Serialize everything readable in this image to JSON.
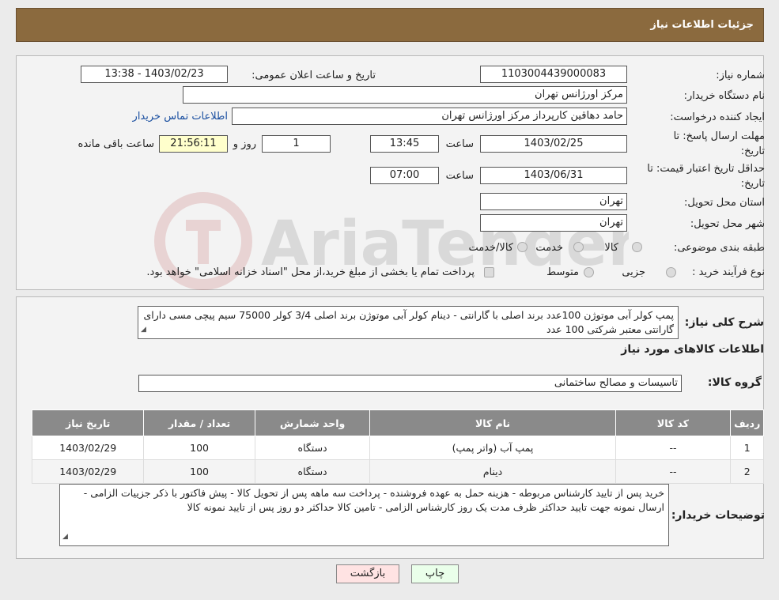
{
  "header": {
    "title": "جزئیات اطلاعات نیاز"
  },
  "form": {
    "need_number_label": "شماره نیاز:",
    "need_number": "1103004439000083",
    "announce_label": "تاریخ و ساعت اعلان عمومی:",
    "announce_value": "1403/02/23 - 13:38",
    "buyer_org_label": "نام دستگاه خریدار:",
    "buyer_org": "مرکز اورژانس تهران",
    "creator_label": "ایجاد کننده درخواست:",
    "creator": "حامد دهاقین کارپرداز مرکز اورژانس تهران",
    "contact_link": "اطلاعات تماس خریدار",
    "reply_deadline_label_1": "مهلت ارسال پاسخ: تا",
    "reply_deadline_label_2": "تاریخ:",
    "reply_date": "1403/02/25",
    "time_label": "ساعت",
    "reply_time": "13:45",
    "days_value": "1",
    "days_label": "روز و",
    "remaining_time": "21:56:11",
    "remaining_label": "ساعت باقی مانده",
    "price_validity_label_1": "حداقل تاریخ اعتبار قیمت: تا",
    "price_validity_label_2": "تاریخ:",
    "price_date": "1403/06/31",
    "price_time": "07:00",
    "province_label": "استان محل تحویل:",
    "province": "تهران",
    "city_label": "شهر محل تحویل:",
    "city": "تهران",
    "category_label": "طبقه بندی موضوعی:",
    "category_options": [
      "کالا",
      "خدمت",
      "کالا/خدمت"
    ],
    "process_label": "نوع فرآیند خرید :",
    "process_options": [
      "جزیی",
      "متوسط"
    ],
    "process_note": "پرداخت تمام یا بخشی از مبلغ خرید،از محل \"اسناد خزانه اسلامی\" خواهد بود."
  },
  "summary": {
    "label": "شرح کلی نیاز:",
    "text": "پمپ کولر آبی موتوژن 100عدد برند اصلی با گارانتی - دینام کولر آبی موتوژن برند اصلی 3/4 کولر 75000 سیم پیچی مسی دارای گارانتی معتبر شرکتی 100 عدد",
    "goods_info_title": "اطلاعات کالاهای مورد نیاز",
    "group_label": "گروه کالا:",
    "group_value": "تاسیسات و مصالح ساختمانی"
  },
  "table": {
    "headers": [
      "ردیف",
      "کد کالا",
      "نام کالا",
      "واحد شمارش",
      "تعداد / مقدار",
      "تاریخ نیاز"
    ],
    "rows": [
      [
        "1",
        "--",
        "پمپ آب (واتر پمپ)",
        "دستگاه",
        "100",
        "1403/02/29"
      ],
      [
        "2",
        "--",
        "دینام",
        "دستگاه",
        "100",
        "1403/02/29"
      ]
    ]
  },
  "buyer_notes": {
    "label": "توضیحات خریدار:",
    "text": "خرید پس از تایید کارشناس مربوطه - هزینه حمل به عهده فروشنده - پرداخت سه ماهه پس از تحویل کالا - پیش فاکتور با ذکر جزییات الزامی - ارسال نمونه جهت تایید حداکثر ظرف مدت یک روز کارشناس الزامی - تامین کالا حداکثر دو روز پس از تایید نمونه کالا"
  },
  "buttons": {
    "print": "چاپ",
    "back": "بازگشت"
  },
  "watermark": {
    "text": "AriaTender.neT"
  }
}
